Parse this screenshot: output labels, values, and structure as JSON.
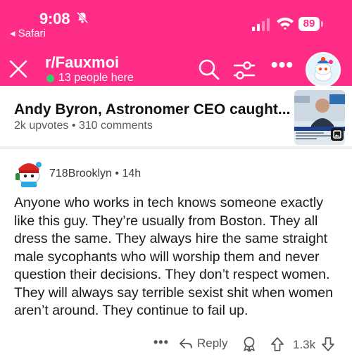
{
  "status_bar": {
    "time": "9:08",
    "back_app": "◂ Safari",
    "battery": "89"
  },
  "header": {
    "subreddit": "r/Fauxmoi",
    "online": "13 people here",
    "icons": [
      "close-icon",
      "search-icon",
      "filter-icon",
      "more-icon",
      "avatar"
    ]
  },
  "post": {
    "title": "Andy Byron, Astronomer CEO caught...",
    "meta": "2k upvotes • 310 comments"
  },
  "comment": {
    "author": "718Brooklyn",
    "age": "• 14h",
    "body": "Anyone who works in tech knows someone exactly like this guy. They’re usually from Boston. They all dress the same. They always hire the same straight male sycophants who will worship them and never question their decisions. They don’t respect women. They will always say terrible sexist shit when women aren’t around. They continue to fail up.",
    "more": "•••",
    "reply_label": "Reply",
    "votes": "1.3k"
  },
  "colors": {
    "header_bg": "#ff2d87",
    "online_dot": "#2fd16b"
  }
}
